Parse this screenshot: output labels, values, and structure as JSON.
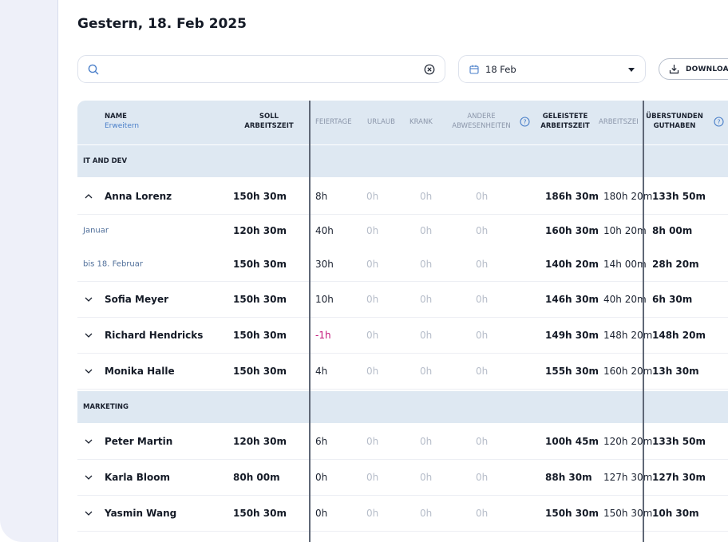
{
  "page_title": "Gestern, 18. Feb 2025",
  "search": {
    "value": "",
    "placeholder": ""
  },
  "date_picker": {
    "label": "18 Feb"
  },
  "download": {
    "label": "DOWNLOA"
  },
  "columns": {
    "name": "NAME",
    "expand": "Erweitern",
    "soll_1": "SOLL",
    "soll_2": "ARBEITSZEIT",
    "feiertage": "FEIERTAGE",
    "urlaub": "URLAUB",
    "krank": "KRANK",
    "andere_1": "ANDERE",
    "andere_2": "ABWESENHEITEN",
    "geleistete_1": "GELEISTETE",
    "geleistete_2": "ARBEITSZEIT",
    "arbeitszeit": "ARBEITSZEI",
    "ueberstunden_1": "ÜBERSTUNDEN",
    "ueberstunden_2": "GUTHABEN"
  },
  "groups": [
    {
      "label": "IT AND DEV"
    },
    {
      "label": "MARKETING"
    }
  ],
  "rows": [
    {
      "name": "Anna Lorenz",
      "soll": "150h 30m",
      "feiertage": "8h",
      "urlaub": "0h",
      "krank": "0h",
      "andere": "0h",
      "geleistete": "186h 30m",
      "arbeitszeit": "180h 20m",
      "guthaben": "133h 50m",
      "expanded": true
    },
    {
      "name": "Januar",
      "soll": "120h 30m",
      "feiertage": "40h",
      "urlaub": "0h",
      "krank": "0h",
      "andere": "0h",
      "geleistete": "160h 30m",
      "arbeitszeit": "10h 20m",
      "guthaben": "8h 00m",
      "sub": true
    },
    {
      "name": "bis 18. Februar",
      "soll": "150h 30m",
      "feiertage": "30h",
      "urlaub": "0h",
      "krank": "0h",
      "andere": "0h",
      "geleistete": "140h 20m",
      "arbeitszeit": "14h 00m",
      "guthaben": "28h 20m",
      "sub": true
    },
    {
      "name": "Sofia Meyer",
      "soll": "150h 30m",
      "feiertage": "10h",
      "urlaub": "0h",
      "krank": "0h",
      "andere": "0h",
      "geleistete": "146h 30m",
      "arbeitszeit": "40h 20m",
      "guthaben": "6h 30m"
    },
    {
      "name": "Richard Hendricks",
      "soll": "150h 30m",
      "feiertage": "-1h",
      "urlaub": "0h",
      "krank": "0h",
      "andere": "0h",
      "geleistete": "149h 30m",
      "arbeitszeit": "148h 20m",
      "guthaben": "148h 20m"
    },
    {
      "name": "Monika Halle",
      "soll": "150h 30m",
      "feiertage": "4h",
      "urlaub": "0h",
      "krank": "0h",
      "andere": "0h",
      "geleistete": "155h 30m",
      "arbeitszeit": "160h 20m",
      "guthaben": "13h 30m"
    },
    {
      "name": "Peter Martin",
      "soll": "120h 30m",
      "feiertage": "6h",
      "urlaub": "0h",
      "krank": "0h",
      "andere": "0h",
      "geleistete": "100h 45m",
      "arbeitszeit": "120h 20m",
      "guthaben": "133h 50m"
    },
    {
      "name": "Karla Bloom",
      "soll": "80h 00m",
      "feiertage": "0h",
      "urlaub": "0h",
      "krank": "0h",
      "andere": "0h",
      "geleistete": "88h 30m",
      "arbeitszeit": "127h 30m",
      "guthaben": "127h 30m"
    },
    {
      "name": "Yasmin Wang",
      "soll": "150h 30m",
      "feiertage": "0h",
      "urlaub": "0h",
      "krank": "0h",
      "andere": "0h",
      "geleistete": "150h 30m",
      "arbeitszeit": "150h 30m",
      "guthaben": "10h 30m"
    }
  ],
  "colors": {
    "header_bg": "#dee8f2",
    "group_bg": "#dee8f2",
    "negative": "#c4187b",
    "muted": "#b6bdc9",
    "link": "#4a7fc9",
    "sidebar_bg": "#eef0f9"
  }
}
